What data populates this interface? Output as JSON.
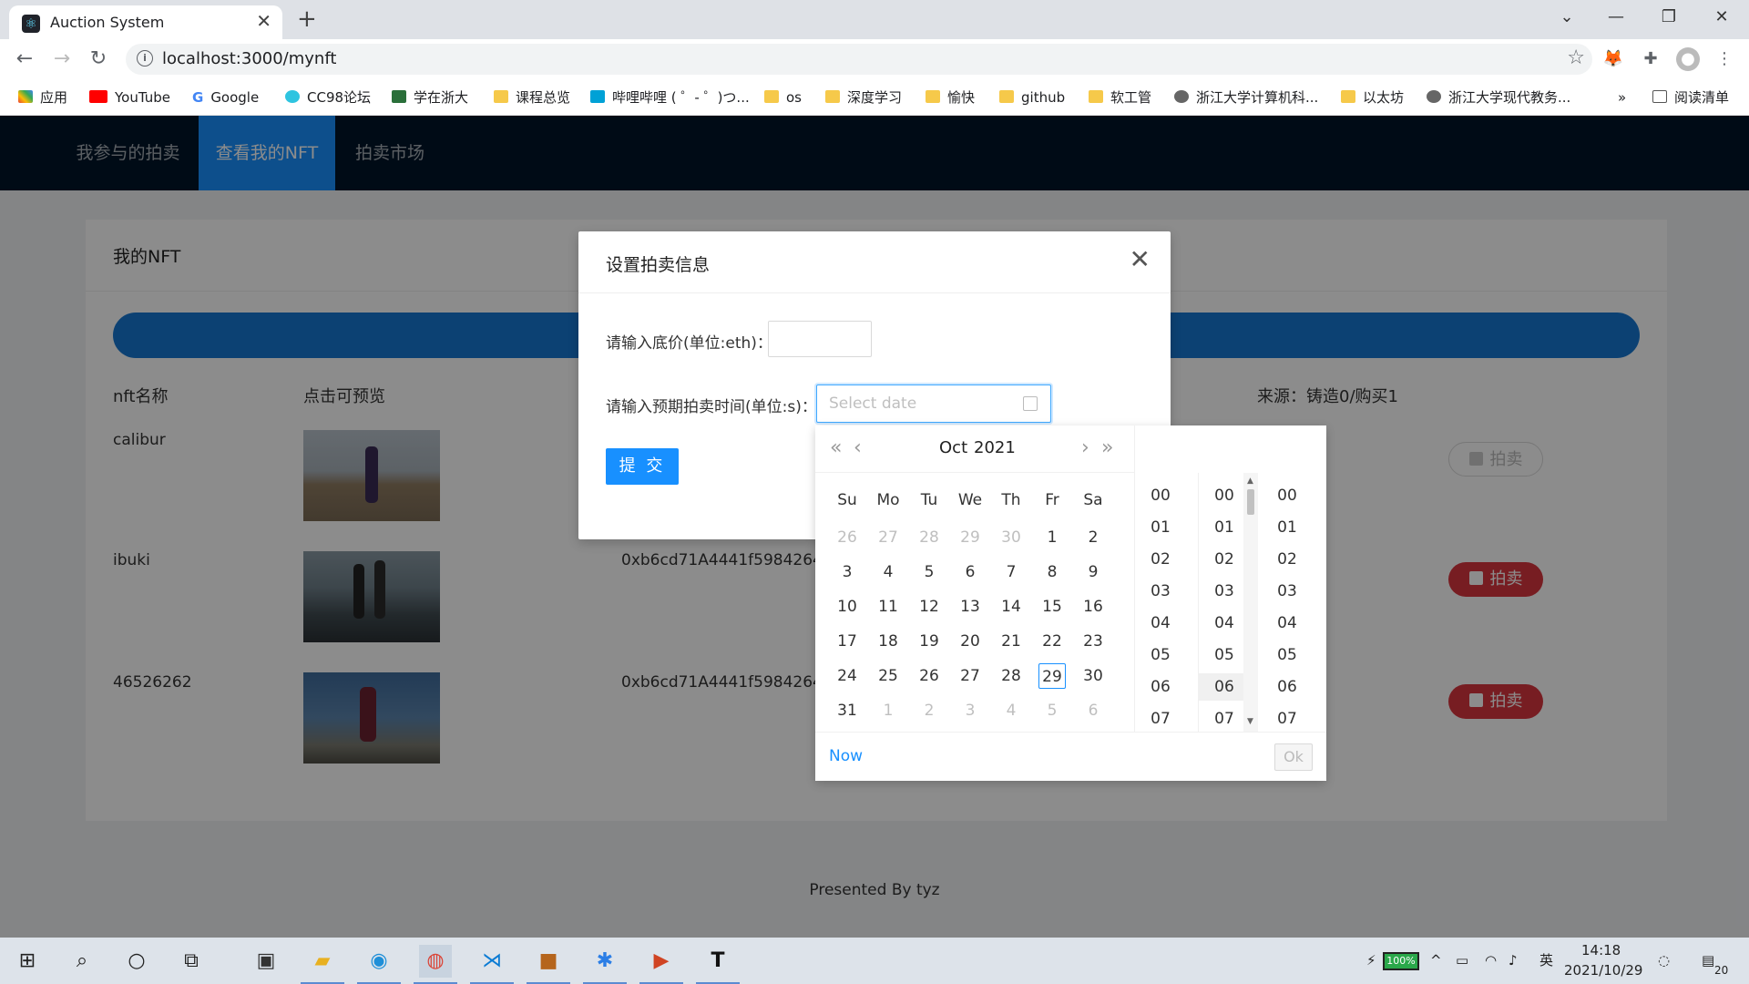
{
  "browser": {
    "tab_title": "Auction System",
    "tab_close": "✕",
    "new_tab": "+",
    "url": "localhost:3000/mynft",
    "bookmarks": [
      "应用",
      "YouTube",
      "Google",
      "CC98论坛",
      "学在浙大",
      "课程总览",
      "哔哩哔哩 ( ゜- ゜)つ...",
      "os",
      "深度学习",
      "愉快",
      "github",
      "软工管",
      "浙江大学计算机科...",
      "以太坊",
      "浙江大学现代教务...",
      "阅读清单"
    ],
    "more_bookmarks": "»"
  },
  "nav": {
    "items": [
      "我参与的拍卖",
      "查看我的NFT",
      "拍卖市场"
    ],
    "active_index": 1
  },
  "card": {
    "title": "我的NFT",
    "columns": [
      "nft名称",
      "点击可预览",
      "来源：铸造0/购买1"
    ],
    "rows": [
      {
        "name": "calibur",
        "address": "",
        "sell": "拍卖",
        "disabled": true
      },
      {
        "name": "ibuki",
        "address": "0xb6cd71A4441f598426489",
        "sell": "拍卖",
        "disabled": false
      },
      {
        "name": "46526262",
        "address": "0xb6cd71A4441f598426489",
        "sell": "拍卖",
        "disabled": false
      }
    ]
  },
  "footer": "Presented By tyz",
  "modal": {
    "title": "设置拍卖信息",
    "close": "✕",
    "price_label": "请输入底价(单位:eth)：",
    "time_label": "请输入预期拍卖时间(单位:s)：",
    "date_placeholder": "Select date",
    "submit": "提 交"
  },
  "picker": {
    "month": "Oct",
    "year": "2021",
    "weekdays": [
      "Su",
      "Mo",
      "Tu",
      "We",
      "Th",
      "Fr",
      "Sa"
    ],
    "days": [
      [
        "26",
        "27",
        "28",
        "29",
        "30",
        "1",
        "2"
      ],
      [
        "3",
        "4",
        "5",
        "6",
        "7",
        "8",
        "9"
      ],
      [
        "10",
        "11",
        "12",
        "13",
        "14",
        "15",
        "16"
      ],
      [
        "17",
        "18",
        "19",
        "20",
        "21",
        "22",
        "23"
      ],
      [
        "24",
        "25",
        "26",
        "27",
        "28",
        "29",
        "30"
      ],
      [
        "31",
        "1",
        "2",
        "3",
        "4",
        "5",
        "6"
      ]
    ],
    "today": "29",
    "time_values": [
      "00",
      "01",
      "02",
      "03",
      "04",
      "05",
      "06",
      "07"
    ],
    "now": "Now",
    "ok": "Ok"
  },
  "taskbar": {
    "battery": "100%",
    "ime": "英",
    "time": "14:18",
    "date": "2021/10/29",
    "notifications": "20"
  },
  "colors": {
    "primary": "#1890ff",
    "nav_bg": "#001529",
    "danger": "#d9363e",
    "progress": "#1677d2"
  }
}
